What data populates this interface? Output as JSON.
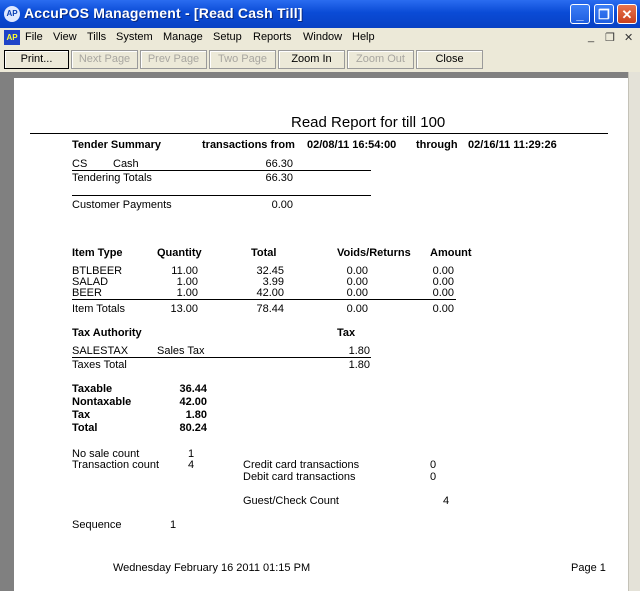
{
  "window": {
    "app_icon": "AP",
    "title": "AccuPOS Management - [Read Cash Till]"
  },
  "menu": {
    "logo": "AP",
    "items": [
      "File",
      "View",
      "Tills",
      "System",
      "Manage",
      "Setup",
      "Reports",
      "Window",
      "Help"
    ]
  },
  "toolbar": {
    "print": "Print...",
    "next": "Next Page",
    "prev": "Prev Page",
    "two": "Two Page",
    "zoomin": "Zoom In",
    "zoomout": "Zoom Out",
    "close": "Close"
  },
  "report": {
    "title": "Read Report for till 100",
    "tender": {
      "heading": "Tender Summary",
      "trans_from": "transactions from",
      "from": "02/08/11 16:54:00",
      "through_label": "through",
      "through": "02/16/11 11:29:26",
      "code": "CS",
      "name": "Cash",
      "cash": "66.30",
      "totals_label": "Tendering Totals",
      "totals": "66.30",
      "cust_label": "Customer Payments",
      "cust": "0.00"
    },
    "items": {
      "headers": {
        "type": "Item Type",
        "qty": "Quantity",
        "total": "Total",
        "voids": "Voids/Returns",
        "amount": "Amount"
      },
      "rows": [
        {
          "type": "BTLBEER",
          "qty": "11.00",
          "total": "32.45",
          "voids": "0.00",
          "amount": "0.00"
        },
        {
          "type": "SALAD",
          "qty": "1.00",
          "total": "3.99",
          "voids": "0.00",
          "amount": "0.00"
        },
        {
          "type": "BEER",
          "qty": "1.00",
          "total": "42.00",
          "voids": "0.00",
          "amount": "0.00"
        }
      ],
      "totals": {
        "label": "Item Totals",
        "qty": "13.00",
        "total": "78.44",
        "voids": "0.00",
        "amount": "0.00"
      }
    },
    "tax": {
      "authority_label": "Tax Authority",
      "tax_label": "Tax",
      "authority": "SALESTAX",
      "desc": "Sales Tax",
      "amount": "1.80",
      "total_label": "Taxes Total",
      "total": "1.80"
    },
    "summary": {
      "taxable_label": "Taxable",
      "taxable": "36.44",
      "nontaxable_label": "Nontaxable",
      "nontaxable": "42.00",
      "tax_label": "Tax",
      "tax": "1.80",
      "total_label": "Total",
      "total": "80.24"
    },
    "counts": {
      "nosale_label": "No sale count",
      "nosale": "1",
      "trans_label": "Transaction count",
      "trans": "4",
      "credit_label": "Credit card transactions",
      "credit": "0",
      "debit_label": "Debit card transactions",
      "debit": "0",
      "guest_label": "Guest/Check Count",
      "guest": "4",
      "seq_label": "Sequence",
      "seq": "1"
    },
    "footer": {
      "date": "Wednesday February 16 2011 01:15 PM",
      "page": "Page 1"
    }
  }
}
